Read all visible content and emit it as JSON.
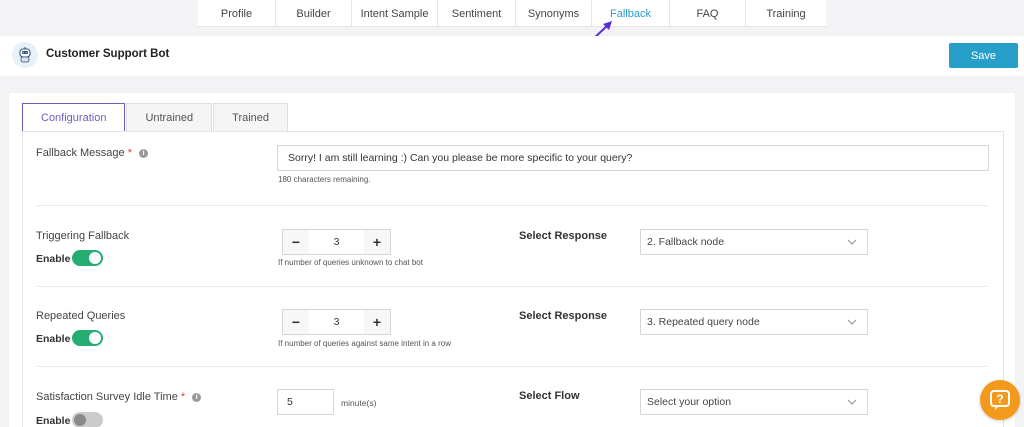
{
  "top_tabs": [
    {
      "label": "Profile",
      "active": false
    },
    {
      "label": "Builder",
      "active": false
    },
    {
      "label": "Intent Sample",
      "active": false
    },
    {
      "label": "Sentiment",
      "active": false
    },
    {
      "label": "Synonyms",
      "active": false
    },
    {
      "label": "Fallback",
      "active": true
    },
    {
      "label": "FAQ",
      "active": false
    },
    {
      "label": "Training",
      "active": false
    }
  ],
  "header": {
    "bot_name": "Customer Support Bot",
    "save_label": "Save"
  },
  "sub_tabs": [
    {
      "label": "Configuration",
      "active": true
    },
    {
      "label": "Untrained",
      "active": false
    },
    {
      "label": "Trained",
      "active": false
    }
  ],
  "fallback_message": {
    "label": "Fallback Message",
    "required_mark": "*",
    "value": "Sorry! I am still learning :) Can you please be more specific to your query?",
    "remaining": "180 characters remaining."
  },
  "triggering_fallback": {
    "label": "Triggering Fallback",
    "enable_label": "Enable",
    "enabled": true,
    "minus": "−",
    "plus": "+",
    "count": "3",
    "hint": "If number of queries unknown to chat bot",
    "response_label": "Select Response",
    "response_value": "2. Fallback node"
  },
  "repeated_queries": {
    "label": "Repeated Queries",
    "enable_label": "Enable",
    "enabled": true,
    "minus": "−",
    "plus": "+",
    "count": "3",
    "hint": "If number of queries against same intent in a row",
    "response_label": "Select Response",
    "response_value": "3. Repeated query node"
  },
  "satisfaction_survey": {
    "label": "Satisfaction Survey Idle Time",
    "required_mark": "*",
    "enable_label": "Enable",
    "enabled": false,
    "value": "5",
    "unit": "minute(s)",
    "flow_label": "Select Flow",
    "flow_placeholder": "Select your option"
  },
  "colors": {
    "accent": "#26a0c8",
    "active_tab": "#2d9ac9",
    "subtab_active": "#6b5fc4",
    "toggle_on": "#25ad72",
    "help_button": "#f39a1d",
    "arrow": "#5b2be0"
  },
  "icons": {
    "bot": "robot-icon",
    "info": "info-icon",
    "chevron": "chevron-down-icon",
    "help": "question-icon",
    "arrow": "annotation-arrow-icon"
  }
}
